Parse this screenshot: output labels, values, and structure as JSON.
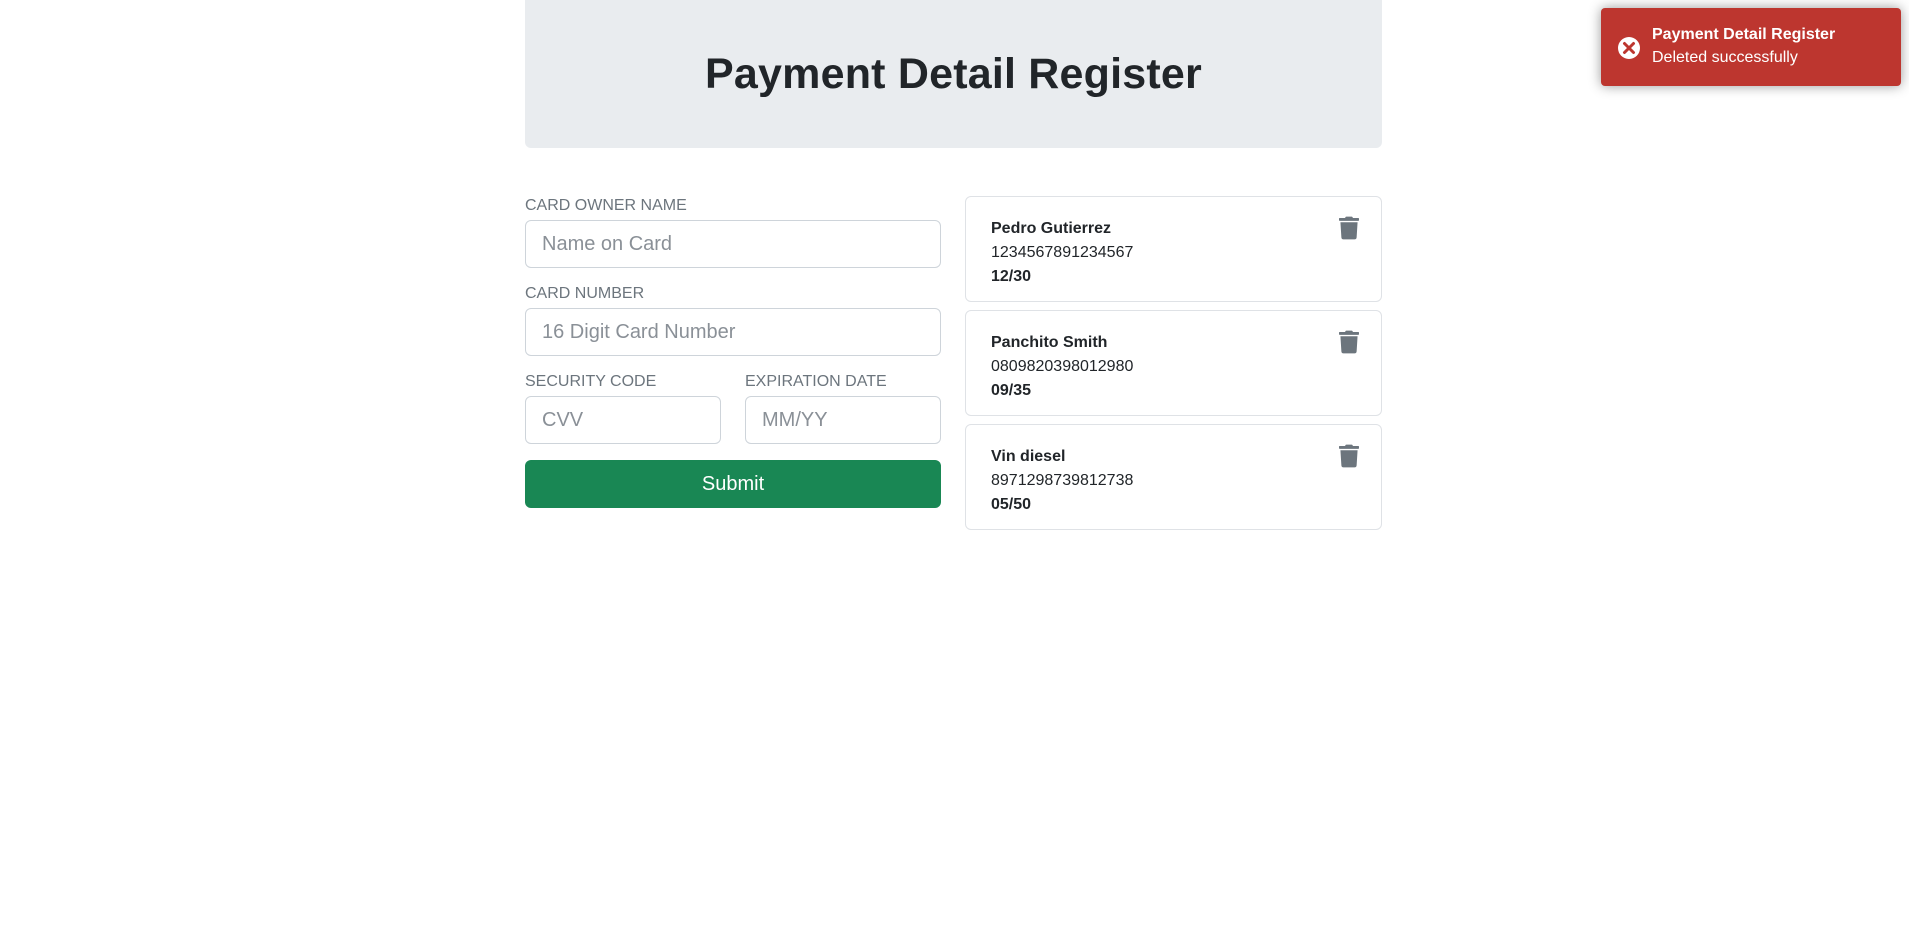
{
  "header": {
    "title": "Payment Detail Register"
  },
  "form": {
    "owner_label": "CARD OWNER NAME",
    "owner_placeholder": "Name on Card",
    "number_label": "CARD NUMBER",
    "number_placeholder": "16 Digit Card Number",
    "cvv_label": "SECURITY CODE",
    "cvv_placeholder": "CVV",
    "exp_label": "EXPIRATION DATE",
    "exp_placeholder": "MM/YY",
    "submit_label": "Submit"
  },
  "cards": [
    {
      "name": "Pedro Gutierrez",
      "number": "1234567891234567",
      "expiration": "12/30",
      "icon": "trash-icon"
    },
    {
      "name": "Panchito Smith",
      "number": "0809820398012980",
      "expiration": "09/35",
      "icon": "trash-icon"
    },
    {
      "name": "Vin diesel",
      "number": "8971298739812738",
      "expiration": "05/50",
      "icon": "trash-icon"
    }
  ],
  "toast": {
    "title": "Payment Detail Register",
    "message": "Deleted successfully",
    "icon": "error-circle-icon",
    "color": "#bd362f"
  },
  "colors": {
    "header_bg": "#e9ecef",
    "submit_bg": "#198754",
    "trash_icon": "#6c757d"
  }
}
